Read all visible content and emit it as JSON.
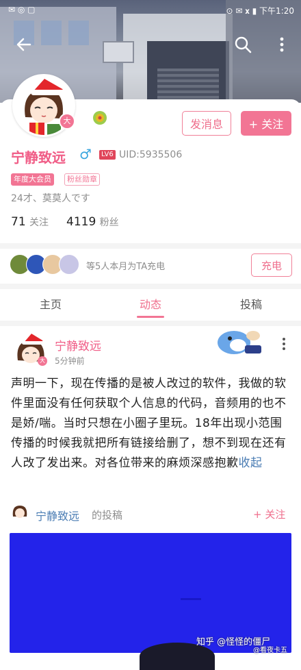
{
  "status_bar": {
    "left": "✉ ◎ ▢",
    "right": "⊙ ✉ 𝐱 ▮ 下午1:20"
  },
  "header": {
    "back_icon": "arrow-left",
    "search_icon": "magnifier",
    "menu_icon": "vertical-dots"
  },
  "profile": {
    "username": "宁静致远",
    "gender_symbol": "♂",
    "level": "LV6",
    "uid": "UID:5935506",
    "tags": [
      "年度大会员",
      "粉丝勋章"
    ],
    "bio": "24才、莫莫人です",
    "following_count": "71",
    "following_label": "关注",
    "followers_count": "4119",
    "followers_label": "粉丝",
    "message_button": "发消息",
    "follow_button": "+ 关注"
  },
  "charge": {
    "text": "等5人本月为TA充电",
    "button": "充电"
  },
  "tabs": [
    {
      "label": "主页",
      "active": false
    },
    {
      "label": "动态",
      "active": true
    },
    {
      "label": "投稿",
      "active": false
    }
  ],
  "post": {
    "author": "宁静致远",
    "time": "5分钟前",
    "text": "声明一下，现在传播的是被人改过的软件，我做的软件里面没有任何获取个人信息的代码，音频用的也不是娇/喘。当时只想在小圈子里玩。18年出现小范围传播的时候我就把所有链接给删了，想不到现在还有人改了发出来。对各位带来的麻烦深感抱歉",
    "collapse_link": "收起",
    "more_icon": "vertical-dots"
  },
  "repost": {
    "author": "宁静致远",
    "suffix": "的投稿",
    "follow": "+ 关注"
  },
  "watermark": "知乎 @怪怪的僵尸",
  "watermark2": "@看夜卡五",
  "colors": {
    "accent": "#f27594",
    "link": "#4a7cb3",
    "repost_bg": "#2323ea"
  }
}
